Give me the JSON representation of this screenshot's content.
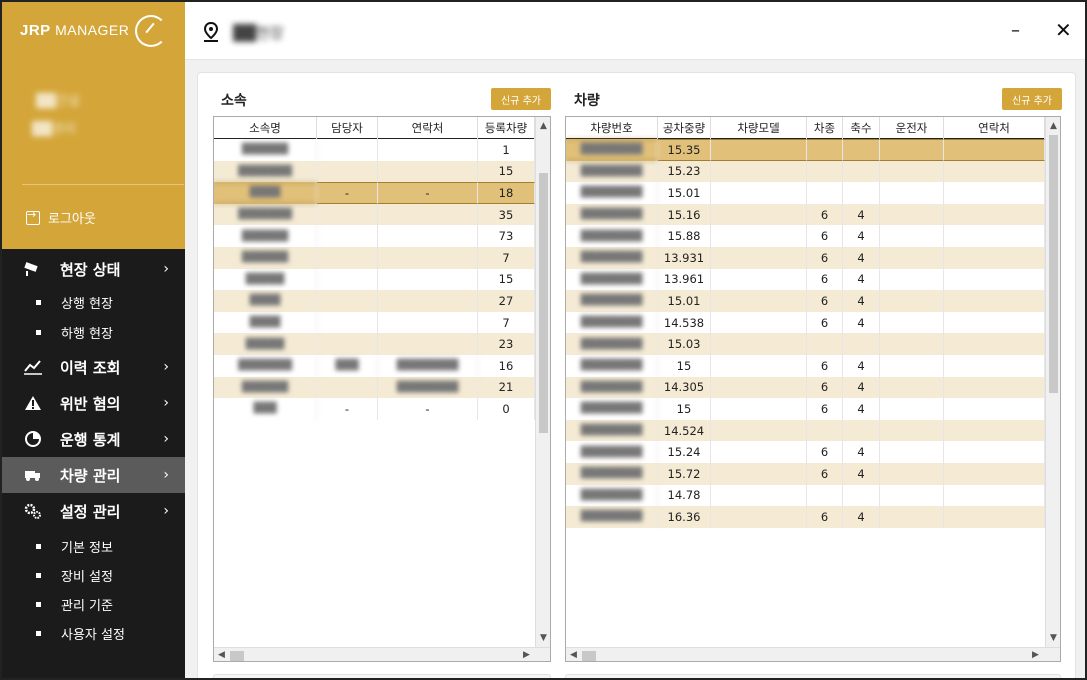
{
  "app": {
    "logo_bold": "JRP",
    "logo_light": " MANAGER",
    "user_line1": "██건설",
    "user_line2": "██관리",
    "logout_label": "로그아웃"
  },
  "header": {
    "site_name": "██현장",
    "minimize": "–",
    "close": "✕"
  },
  "menu": {
    "items": [
      {
        "label": "현장 상태",
        "icon": "cctv-icon"
      },
      {
        "label": "이력 조회",
        "icon": "chart-line-icon"
      },
      {
        "label": "위반 혐의",
        "icon": "warning-icon"
      },
      {
        "label": "운행 통계",
        "icon": "pie-chart-icon"
      },
      {
        "label": "차량 관리",
        "icon": "truck-icon"
      },
      {
        "label": "설정 관리",
        "icon": "gears-icon"
      }
    ],
    "sub_status": [
      "상행 현장",
      "하행 현장"
    ],
    "sub_settings": [
      "기본 정보",
      "장비 설정",
      "관리 기준",
      "사용자 설정"
    ],
    "active": "차량 관리",
    "chevron": "›"
  },
  "affiliation": {
    "title": "소속",
    "add_label": "신규 추가",
    "columns": [
      "소속명",
      "담당자",
      "연락처",
      "등록차량"
    ],
    "rows": [
      {
        "name": "██████",
        "manager": "",
        "contact": "",
        "count": "1"
      },
      {
        "name": "███████",
        "manager": "",
        "contact": "",
        "count": "15"
      },
      {
        "name": "████",
        "manager": "-",
        "contact": "-",
        "count": "18"
      },
      {
        "name": "███████",
        "manager": "",
        "contact": "",
        "count": "35"
      },
      {
        "name": "██████",
        "manager": "",
        "contact": "",
        "count": "73"
      },
      {
        "name": "██████",
        "manager": "",
        "contact": "",
        "count": "7"
      },
      {
        "name": "█████",
        "manager": "",
        "contact": "",
        "count": "15"
      },
      {
        "name": "████",
        "manager": "",
        "contact": "",
        "count": "27"
      },
      {
        "name": "████",
        "manager": "",
        "contact": "",
        "count": "7"
      },
      {
        "name": "█████",
        "manager": "",
        "contact": "",
        "count": "23"
      },
      {
        "name": "███████",
        "manager": "███",
        "contact": "████████",
        "count": "16"
      },
      {
        "name": "██████",
        "manager": "",
        "contact": "████████",
        "count": "21"
      },
      {
        "name": "███",
        "manager": "-",
        "contact": "-",
        "count": "0"
      }
    ],
    "selected_index": 2
  },
  "vehicles": {
    "title": "차량",
    "add_label": "신규 추가",
    "columns": [
      "차량번호",
      "공차중량",
      "차량모델",
      "차종",
      "축수",
      "운전자",
      "연락처"
    ],
    "rows": [
      {
        "plate": "████████",
        "weight": "15.35",
        "model": "",
        "type": "",
        "axles": "",
        "driver": "",
        "contact": ""
      },
      {
        "plate": "████████",
        "weight": "15.23",
        "model": "",
        "type": "",
        "axles": "",
        "driver": "",
        "contact": ""
      },
      {
        "plate": "████████",
        "weight": "15.01",
        "model": "",
        "type": "",
        "axles": "",
        "driver": "",
        "contact": ""
      },
      {
        "plate": "████████",
        "weight": "15.16",
        "model": "",
        "type": "6",
        "axles": "4",
        "driver": "",
        "contact": ""
      },
      {
        "plate": "████████",
        "weight": "15.88",
        "model": "",
        "type": "6",
        "axles": "4",
        "driver": "",
        "contact": ""
      },
      {
        "plate": "████████",
        "weight": "13.931",
        "model": "",
        "type": "6",
        "axles": "4",
        "driver": "",
        "contact": ""
      },
      {
        "plate": "████████",
        "weight": "13.961",
        "model": "",
        "type": "6",
        "axles": "4",
        "driver": "",
        "contact": ""
      },
      {
        "plate": "████████",
        "weight": "15.01",
        "model": "",
        "type": "6",
        "axles": "4",
        "driver": "",
        "contact": ""
      },
      {
        "plate": "████████",
        "weight": "14.538",
        "model": "",
        "type": "6",
        "axles": "4",
        "driver": "",
        "contact": ""
      },
      {
        "plate": "████████",
        "weight": "15.03",
        "model": "",
        "type": "",
        "axles": "",
        "driver": "",
        "contact": ""
      },
      {
        "plate": "████████",
        "weight": "15",
        "model": "",
        "type": "6",
        "axles": "4",
        "driver": "",
        "contact": ""
      },
      {
        "plate": "████████",
        "weight": "14.305",
        "model": "",
        "type": "6",
        "axles": "4",
        "driver": "",
        "contact": ""
      },
      {
        "plate": "████████",
        "weight": "15",
        "model": "",
        "type": "6",
        "axles": "4",
        "driver": "",
        "contact": ""
      },
      {
        "plate": "████████",
        "weight": "14.524",
        "model": "",
        "type": "",
        "axles": "",
        "driver": "",
        "contact": ""
      },
      {
        "plate": "████████",
        "weight": "15.24",
        "model": "",
        "type": "6",
        "axles": "4",
        "driver": "",
        "contact": ""
      },
      {
        "plate": "████████",
        "weight": "15.72",
        "model": "",
        "type": "6",
        "axles": "4",
        "driver": "",
        "contact": ""
      },
      {
        "plate": "████████",
        "weight": "14.78",
        "model": "",
        "type": "",
        "axles": "",
        "driver": "",
        "contact": ""
      },
      {
        "plate": "████████",
        "weight": "16.36",
        "model": "",
        "type": "6",
        "axles": "4",
        "driver": "",
        "contact": ""
      }
    ],
    "selected_index": 0
  },
  "colors": {
    "accent": "#d4a63a",
    "row_alt": "#f5ebd5",
    "row_selected": "#e1c07a",
    "sidebar_bg": "#1b1b1b",
    "sidebar_active": "#5b5b5b"
  }
}
